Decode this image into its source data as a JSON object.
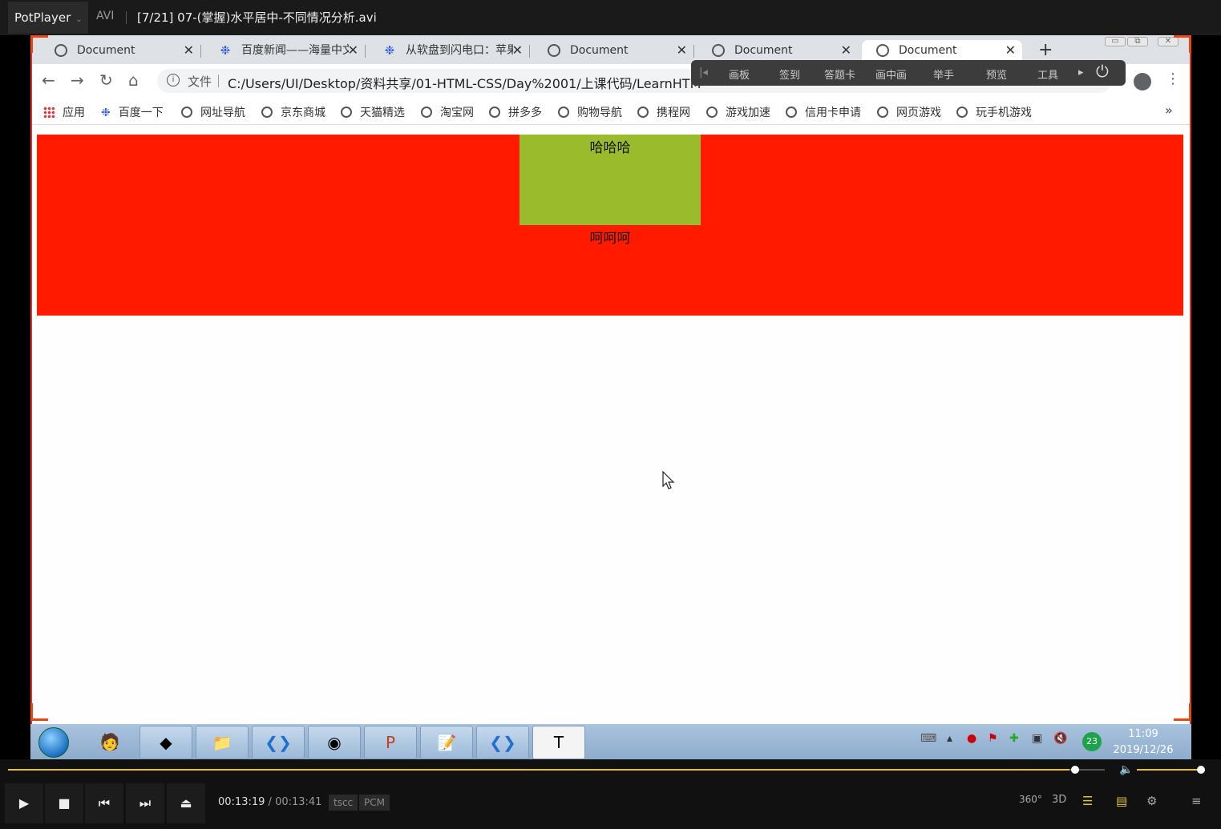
{
  "player": {
    "brand": "PotPlayer",
    "format": "AVI",
    "file_title": "[7/21] 07-(掌握)水平居中-不同情况分析.avi"
  },
  "browser": {
    "tabs": [
      {
        "label": "Document",
        "icon": "globe-icon"
      },
      {
        "label": "百度新闻——海量中文",
        "icon": "baidu-icon"
      },
      {
        "label": "从软盘到闪电口：苹果",
        "icon": "baidu-icon"
      },
      {
        "label": "Document",
        "icon": "globe-icon"
      },
      {
        "label": "Document",
        "icon": "globe-icon"
      },
      {
        "label": "Document",
        "icon": "globe-icon",
        "active": true
      }
    ],
    "new_tab": "+",
    "address": {
      "scheme_label": "文件",
      "url": "C:/Users/UI/Desktop/资料共享/01-HTML-CSS/Day%2001/上课代码/LearnHTM"
    },
    "bookmarks": [
      "应用",
      "百度一下",
      "网址导航",
      "京东商城",
      "天猫精选",
      "淘宝网",
      "拼多多",
      "购物导航",
      "携程网",
      "游戏加速",
      "信用卡申请",
      "网页游戏",
      "玩手机游戏"
    ],
    "more_bookmarks": "»"
  },
  "overlay_toolbar": {
    "items": [
      "画板",
      "签到",
      "答题卡",
      "画中画",
      "举手",
      "预览",
      "工具"
    ]
  },
  "page": {
    "box_text": "哈哈哈",
    "below_text": "呵呵呵",
    "colors": {
      "band": "#ff1a00",
      "box": "#9abc2c"
    }
  },
  "taskbar": {
    "clock_time": "11:09",
    "clock_date": "2019/12/26",
    "tray_badge": "23"
  },
  "controls": {
    "current_time": "00:13:19",
    "total_time": "00:13:41",
    "separator": "/",
    "video_codec": "tscc",
    "audio_codec": "PCM",
    "progress_fraction": 0.973,
    "accent": "#e3c23a"
  }
}
